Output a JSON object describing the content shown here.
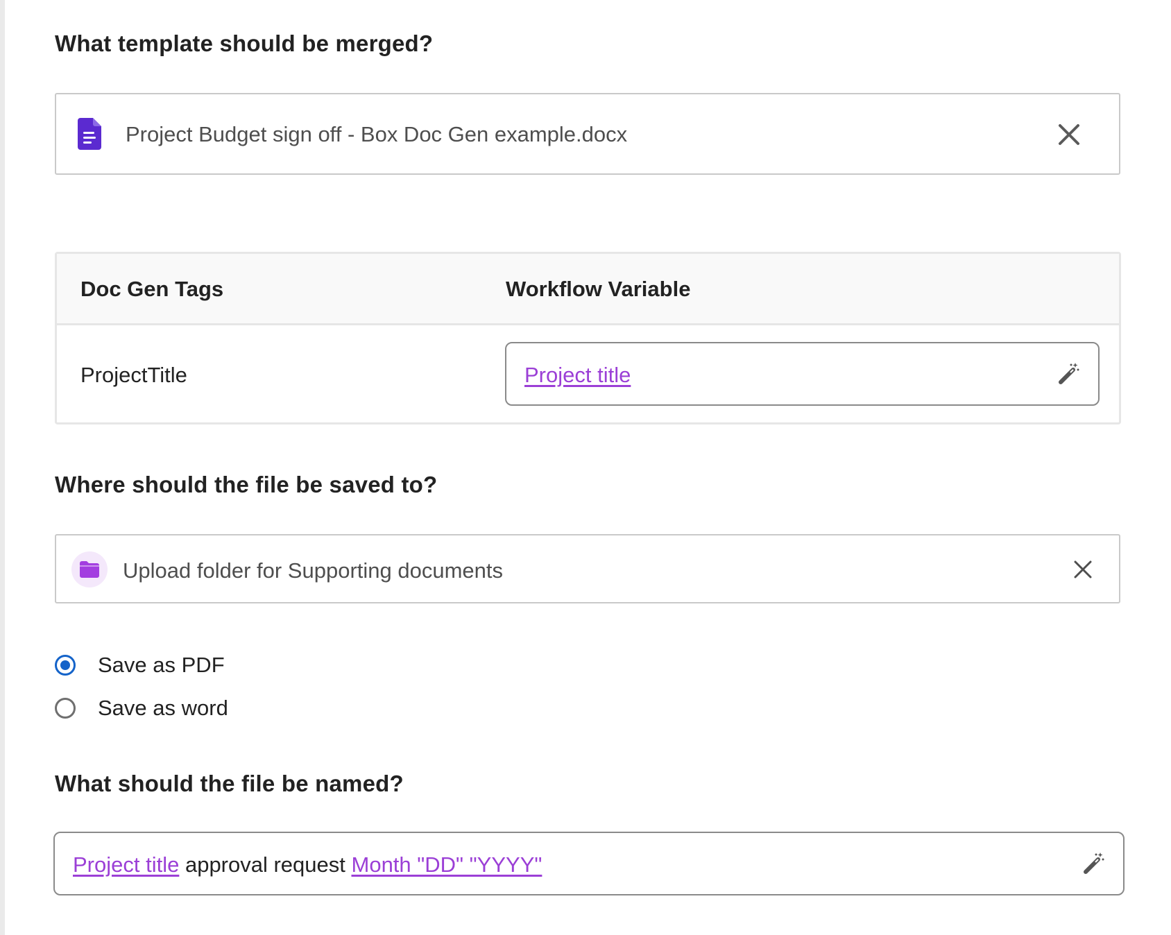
{
  "template_section": {
    "title": "What template should be merged?",
    "file_name": "Project Budget sign off - Box Doc Gen example.docx",
    "file_icon": "document-icon",
    "remove_icon": "close-icon"
  },
  "tags_table": {
    "headers": [
      "Doc Gen Tags",
      "Workflow Variable"
    ],
    "rows": [
      {
        "tag": "ProjectTitle",
        "variable": "Project title"
      }
    ],
    "edit_icon": "magic-wand-icon"
  },
  "save_section": {
    "title": "Where should the file be saved to?",
    "folder_name": "Upload folder for Supporting documents",
    "folder_icon": "folder-icon",
    "remove_icon": "close-icon"
  },
  "format_options": {
    "options": [
      {
        "label": "Save as PDF",
        "checked": true
      },
      {
        "label": "Save as word",
        "checked": false
      }
    ]
  },
  "name_section": {
    "title": "What should the file be named?",
    "parts": [
      {
        "text": "Project title",
        "variable": true
      },
      {
        "text": " approval request ",
        "variable": false
      },
      {
        "text": "Month \"DD\" \"YYYY\"",
        "variable": true
      }
    ],
    "edit_icon": "magic-wand-icon"
  },
  "colors": {
    "variable_link": "#9b3fd6",
    "radio_selected": "#1463c9",
    "doc_icon": "#5b2ad0",
    "folder_icon": "#a33ee0",
    "folder_icon_bg": "#f4e8fb"
  }
}
